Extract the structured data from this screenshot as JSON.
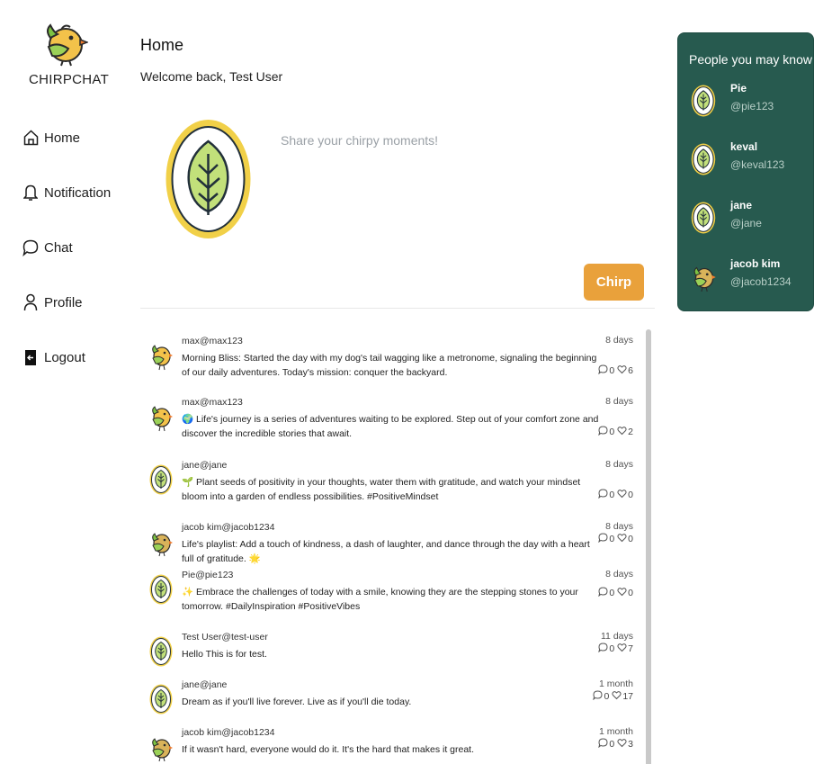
{
  "brand": {
    "name": "CHIRPCHAT"
  },
  "nav": [
    {
      "label": "Home",
      "icon": "home-icon"
    },
    {
      "label": "Notification",
      "icon": "bell-icon"
    },
    {
      "label": "Chat",
      "icon": "chat-icon"
    },
    {
      "label": "Profile",
      "icon": "user-icon"
    },
    {
      "label": "Logout",
      "icon": "logout-icon"
    }
  ],
  "header": {
    "title": "Home",
    "welcome": "Welcome back, Test User"
  },
  "composer": {
    "placeholder": "Share your chirpy moments!",
    "submit_label": "Chirp"
  },
  "posts": [
    {
      "name": "max",
      "handle": "@max123",
      "time": "8 days",
      "text": "Morning Bliss: Started the day with my dog's tail wagging like a metronome, signaling the beginning of our daily adventures. Today's mission: conquer the backyard.",
      "comments": "0",
      "likes": "6",
      "avatar": "bird"
    },
    {
      "name": "max",
      "handle": "@max123",
      "time": "8 days",
      "text": "🌍 Life's journey is a series of adventures waiting to be explored. Step out of your comfort zone and discover the incredible stories that await.",
      "comments": "0",
      "likes": "2",
      "avatar": "bird"
    },
    {
      "name": "jane",
      "handle": "@jane",
      "time": "8 days",
      "text": "🌱 Plant seeds of positivity in your thoughts, water them with gratitude, and watch your mindset bloom into a garden of endless possibilities. #PositiveMindset",
      "comments": "0",
      "likes": "0",
      "avatar": "leaf"
    },
    {
      "name": "jacob kim",
      "handle": "@jacob1234",
      "time": "8 days",
      "text": "Life's playlist: Add a touch of kindness, a dash of laughter, and dance through the day with a heart full of gratitude. 🌟",
      "comments": "0",
      "likes": "0",
      "avatar": "bird2"
    },
    {
      "name": "Pie",
      "handle": "@pie123",
      "time": "8 days",
      "text": "✨ Embrace the challenges of today with a smile, knowing they are the stepping stones to your tomorrow. #DailyInspiration #PositiveVibes",
      "comments": "0",
      "likes": "0",
      "avatar": "leaf"
    },
    {
      "name": "Test User",
      "handle": "@test-user",
      "time": "11 days",
      "text": "Hello This is for test.",
      "comments": "0",
      "likes": "7",
      "avatar": "leaf"
    },
    {
      "name": "jane",
      "handle": "@jane",
      "time": "1 month",
      "text": "Dream as if you'll live forever. Live as if you'll die today.",
      "comments": "0",
      "likes": "17",
      "avatar": "leaf"
    },
    {
      "name": "jacob kim",
      "handle": "@jacob1234",
      "time": "1 month",
      "text": "If it wasn't hard, everyone would do it. It's the hard that makes it great.",
      "comments": "0",
      "likes": "3",
      "avatar": "bird2"
    }
  ],
  "suggestions": {
    "title": "People you may know",
    "people": [
      {
        "name": "Pie",
        "handle": "@pie123",
        "avatar": "leaf"
      },
      {
        "name": "keval",
        "handle": "@keval123",
        "avatar": "leaf"
      },
      {
        "name": "jane",
        "handle": "@jane",
        "avatar": "leaf"
      },
      {
        "name": "jacob kim",
        "handle": "@jacob1234",
        "avatar": "bird2"
      }
    ]
  },
  "colors": {
    "accent": "#e9a13b",
    "panel": "#275a4f",
    "leaf_ring": "#f1d048",
    "leaf_fill": "#c2e07a"
  }
}
